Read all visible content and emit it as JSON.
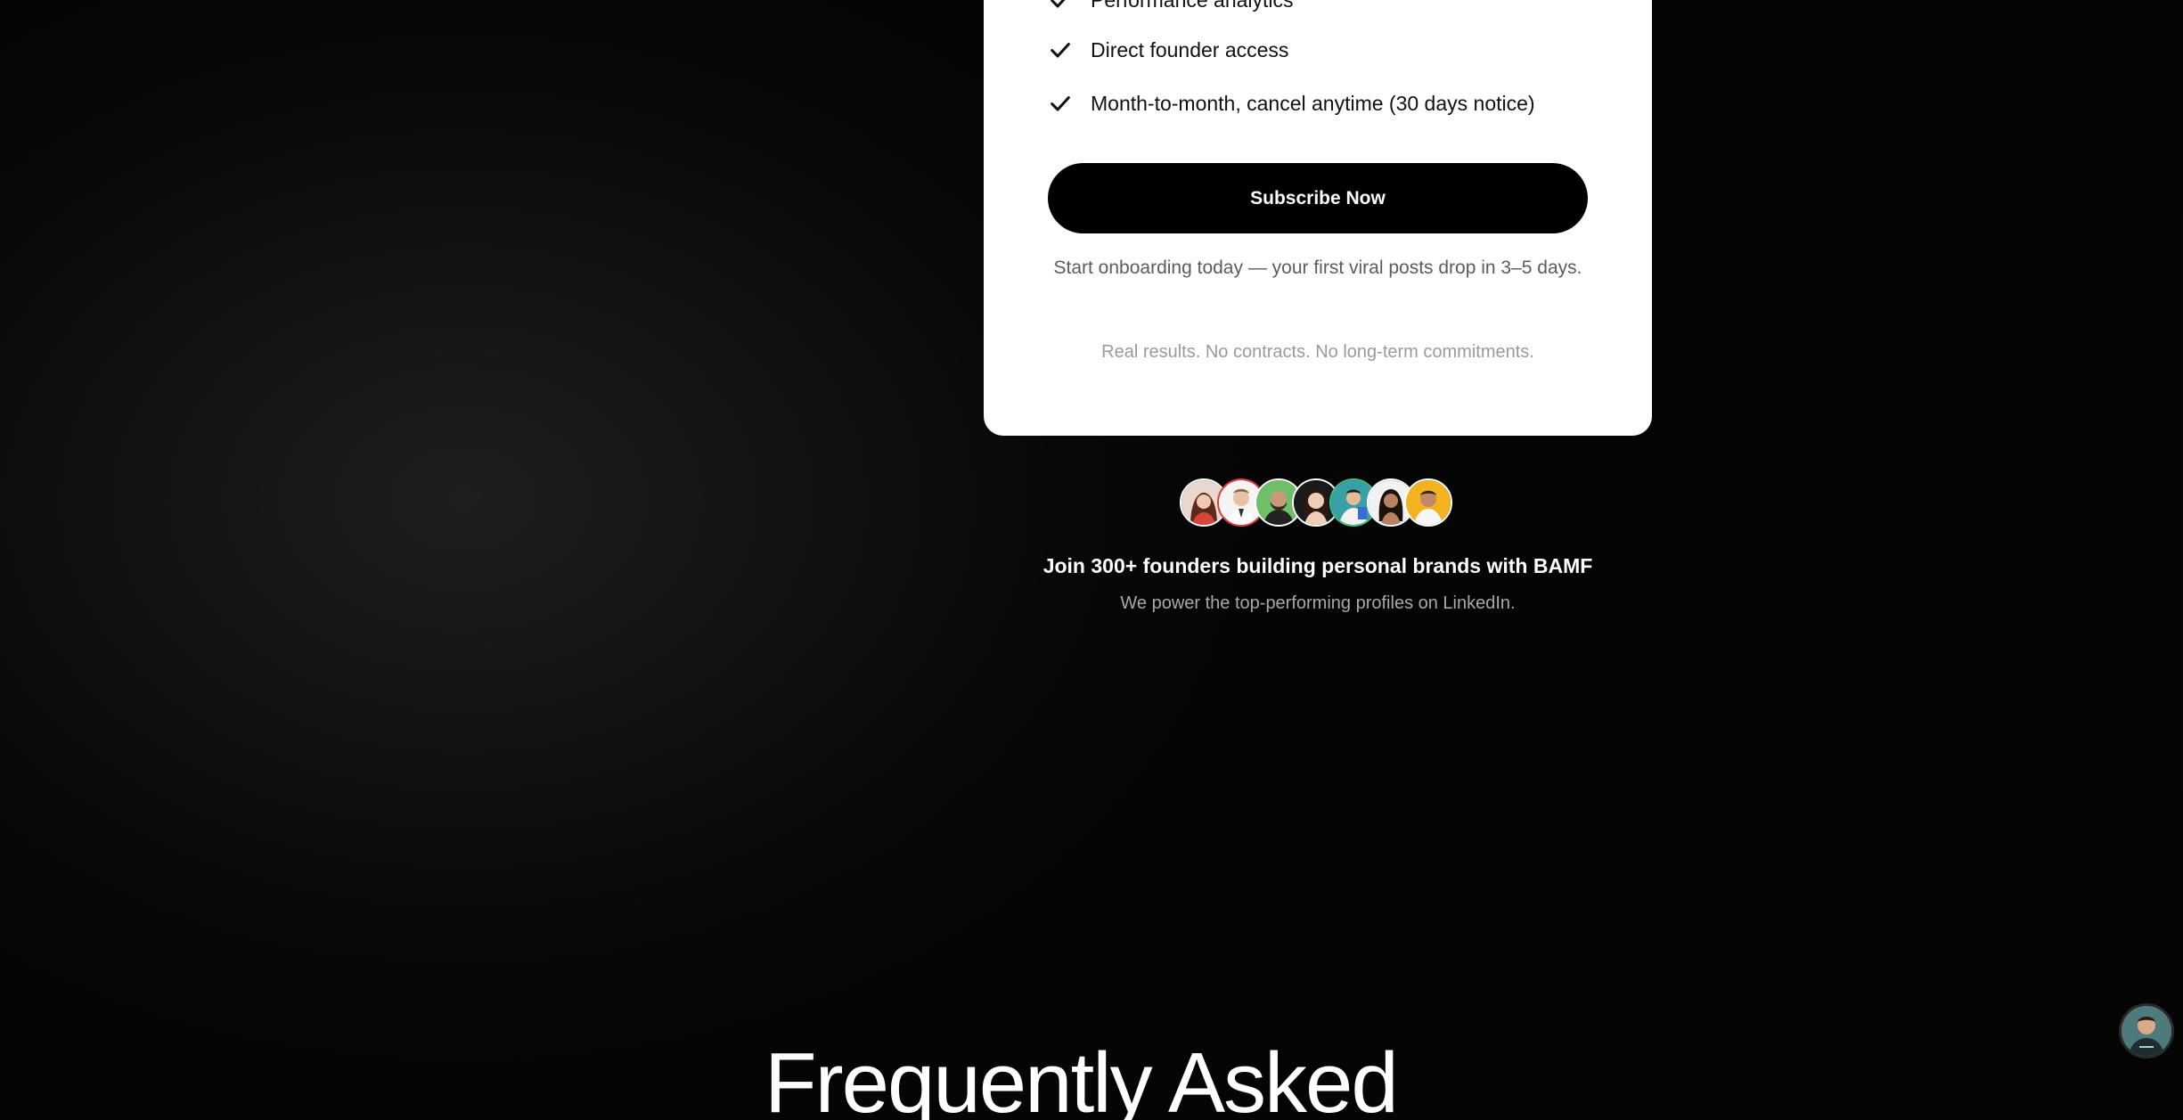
{
  "pricing_card": {
    "features": [
      "Performance analytics",
      "Direct founder access",
      "Month-to-month, cancel anytime (30 days notice)"
    ],
    "subscribe_label": "Subscribe Now",
    "onboarding_note": "Start onboarding today — your first viral posts drop in 3–5 days.",
    "commitment_note": "Real results. No contracts. No long-term commitments."
  },
  "social_proof": {
    "avatars": [
      {
        "icon": "founder-avatar-1",
        "bg": "#d9443a"
      },
      {
        "icon": "founder-avatar-2",
        "bg": "#e13b3b"
      },
      {
        "icon": "founder-avatar-3",
        "bg": "#6fbf6a"
      },
      {
        "icon": "founder-avatar-4",
        "bg": "#1a1a1a"
      },
      {
        "icon": "founder-avatar-5",
        "bg": "#3aa0a8"
      },
      {
        "icon": "founder-avatar-6",
        "bg": "#f2f2f2"
      },
      {
        "icon": "founder-avatar-7",
        "bg": "#f3b21f"
      }
    ],
    "title": "Join 300+ founders building personal brands with BAMF",
    "subtitle": "We power the top-performing profiles on LinkedIn."
  },
  "faq": {
    "heading": "Frequently Asked"
  },
  "chat_launcher": {
    "icon": "founder-chat-avatar-icon"
  },
  "colors": {
    "background": "#0a0a0a",
    "card": "#ffffff",
    "button": "#000000",
    "muted_text": "#a8a8a8"
  }
}
